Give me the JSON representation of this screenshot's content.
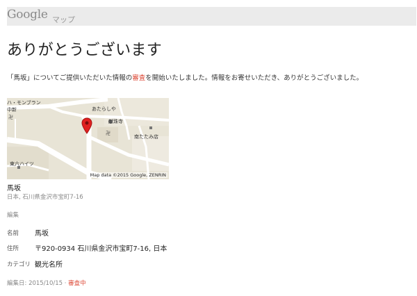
{
  "header": {
    "logo_google": "Google",
    "logo_maps": "マップ"
  },
  "page_title": "ありがとうございます",
  "message": {
    "part1": "「馬坂」についてご提供いただいた情報の",
    "link": "審査",
    "part2": "を開始いたしました。情報をお寄せいただき、ありがとうございました。"
  },
  "map": {
    "labels": {
      "mont_blanc": "ハ・モンブラン",
      "shin": "中新",
      "temple_mark": "卍",
      "atarashiya": "あたらしや",
      "kenjuji": "献珠寺",
      "temple_mark2": "卍",
      "minami_tatami": "南たたみ店",
      "higashi_haitsu": "東六ハイツ"
    },
    "attribution": "Map data ©2015 Google, ZENRIN",
    "colors": {
      "background": "#e8e4d6",
      "road": "#ffffff",
      "pin": "#e02020"
    }
  },
  "place": {
    "name": "馬坂",
    "address": "日本, 石川県金沢市宝町7-16"
  },
  "edit_label": "編集",
  "details": [
    {
      "label": "名前",
      "value": "馬坂"
    },
    {
      "label": "住所",
      "value": "〒920-0934 石川県金沢市宝町7-16, 日本"
    },
    {
      "label": "カテゴリ",
      "value": "観光名所"
    }
  ],
  "footer": {
    "edited": "編集日: 2015/10/15 · ",
    "status": "審査中"
  },
  "colors": {
    "accent": "#dd4b39",
    "header_bg": "#ebebeb"
  }
}
